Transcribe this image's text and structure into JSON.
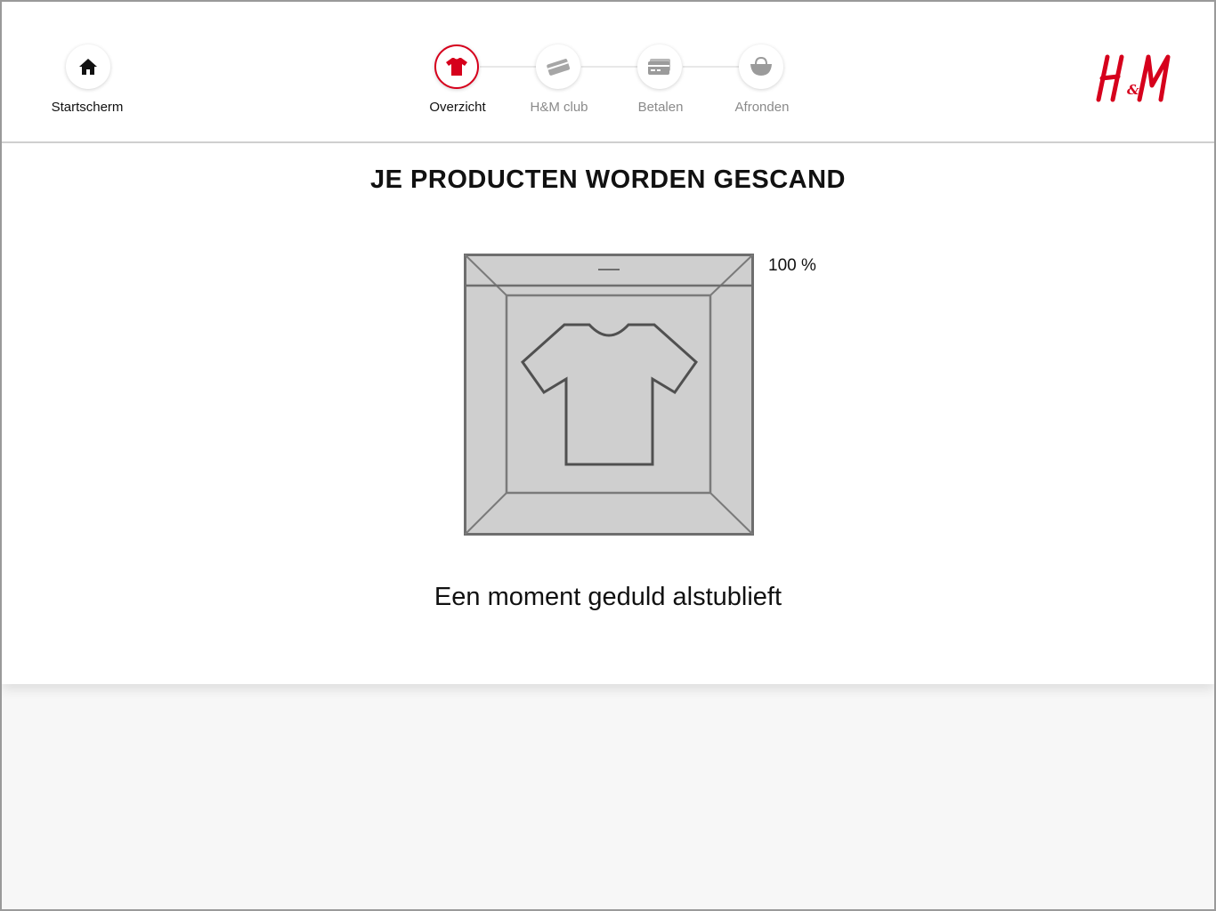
{
  "nav": {
    "home_label": "Startscherm",
    "steps": [
      {
        "label": "Overzicht",
        "icon": "tshirt-icon",
        "state": "active"
      },
      {
        "label": "H&M club",
        "icon": "card-icon",
        "state": "inactive"
      },
      {
        "label": "Betalen",
        "icon": "payment-card-icon",
        "state": "inactive"
      },
      {
        "label": "Afronden",
        "icon": "basket-icon",
        "state": "inactive"
      }
    ],
    "logo_text": "H&M"
  },
  "main": {
    "title": "JE PRODUCTEN WORDEN GESCAND",
    "progress_label": "100 %",
    "progress_value": 100,
    "message": "Een moment geduld alstublieft"
  },
  "colors": {
    "accent": "#d6001c",
    "muted_text": "#8a8a8a",
    "icon_gray": "#9b9b9b",
    "box_fill": "#cfcfcf",
    "box_stroke": "#666666"
  }
}
